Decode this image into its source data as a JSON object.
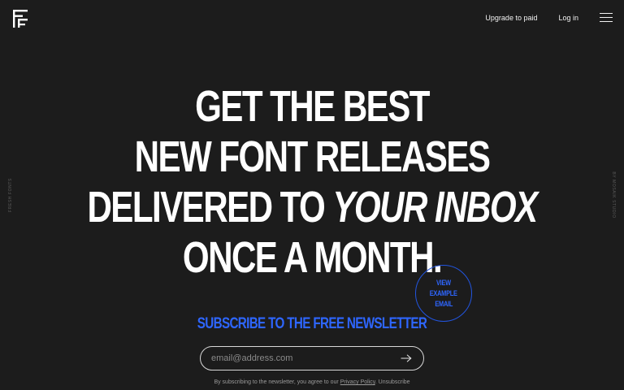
{
  "header": {
    "logo_icon": "ff-logo-icon",
    "nav": {
      "upgrade_label": "Upgrade to paid",
      "login_label": "Log in"
    },
    "menu_icon": "hamburger-menu-icon"
  },
  "side": {
    "left_label": "FRESH FONTS",
    "right_label": "BY MOSAIK STUDIO"
  },
  "hero": {
    "line1": "GET THE BEST",
    "line2": "NEW FONT RELEASES",
    "line3_plain": "DELIVERED TO ",
    "line3_italic": "YOUR INBOX",
    "line4": "ONCE A MONTH."
  },
  "badge": {
    "line1": "VIEW",
    "line2": "EXAMPLE",
    "line3": "EMAIL"
  },
  "subscribe": {
    "title": "SUBSCRIBE TO THE FREE NEWSLETTER",
    "email_placeholder": "email@address.com",
    "submit_icon": "arrow-right-icon"
  },
  "fineprint": {
    "before": "By subscribing to the newsletter, you agree to our ",
    "privacy_label": "Privacy Policy",
    "after": ". Unsubscribe"
  },
  "colors": {
    "background": "#1c1c1c",
    "accent": "#2e66ff",
    "text": "#ffffff"
  }
}
